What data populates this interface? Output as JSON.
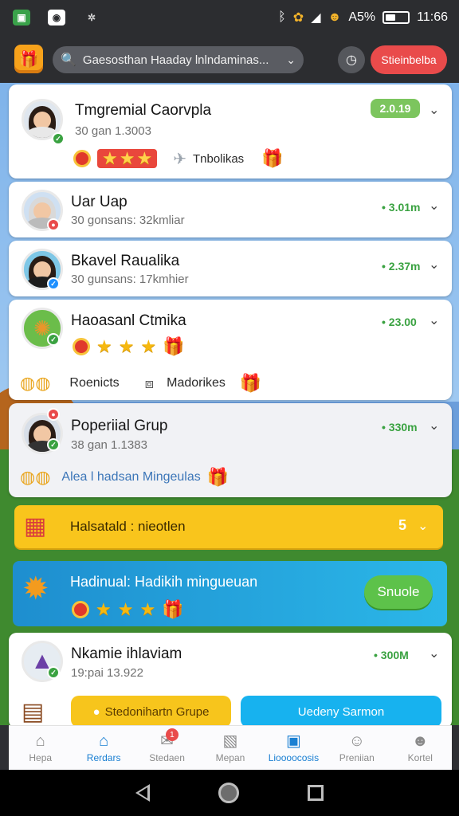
{
  "status": {
    "battery": "A5%",
    "time": "11:66"
  },
  "header": {
    "search_text": "Gaesosthan Haaday lnlndaminas...",
    "action_button": "Stieinbelba"
  },
  "cards": [
    {
      "name": "Tmgremial Caorvpla",
      "sub": "30 gan 1.3003",
      "badge": "2.0.19",
      "tag": "Tnbolikas"
    },
    {
      "name": "Uar Uap",
      "sub": "30 gonsans: 32kmliar",
      "value": "• 3.01m"
    },
    {
      "name": "Bkavel Raualika",
      "sub": "30 gunsans: 17kmhier",
      "value": "• 2.37m"
    },
    {
      "name": "Haoasanl Ctmika",
      "value": "• 23.00",
      "item1": "Roenicts",
      "item2": "Madorikes"
    },
    {
      "name": "Poperiial Grup",
      "sub": "38 gan 1.1383",
      "value": "• 330m",
      "note": "Alea l hadsan Mingeulas"
    },
    {
      "name": "Nkamie ihlaviam",
      "sub": "19:pai 13.922",
      "value": "• 300M"
    }
  ],
  "banner_yellow": {
    "label": "Halsatald : nieotlen",
    "count": "5"
  },
  "banner_blue": {
    "label": "Hadinual: Hadikih mingueuan",
    "button": "Snuole"
  },
  "bottom_pills": {
    "left": "Stedonihartn Grupe",
    "right": "Uedeny Sarmon"
  },
  "tabs": [
    {
      "label": "Hepa",
      "icon": "home-icon"
    },
    {
      "label": "Rerdars",
      "icon": "house-active-icon"
    },
    {
      "label": "Stedaen",
      "icon": "chat-icon",
      "badge": "1"
    },
    {
      "label": "Mepan",
      "icon": "frame-icon"
    },
    {
      "label": "Lioooocosis",
      "icon": "calendar-icon"
    },
    {
      "label": "Preniian",
      "icon": "person-icon"
    },
    {
      "label": "Kortel",
      "icon": "person-icon"
    }
  ],
  "colors": {
    "accent_red": "#e94b4b",
    "accent_green": "#5dc24a",
    "accent_blue": "#1a7fd2",
    "banner_yellow": "#f9c51c"
  }
}
